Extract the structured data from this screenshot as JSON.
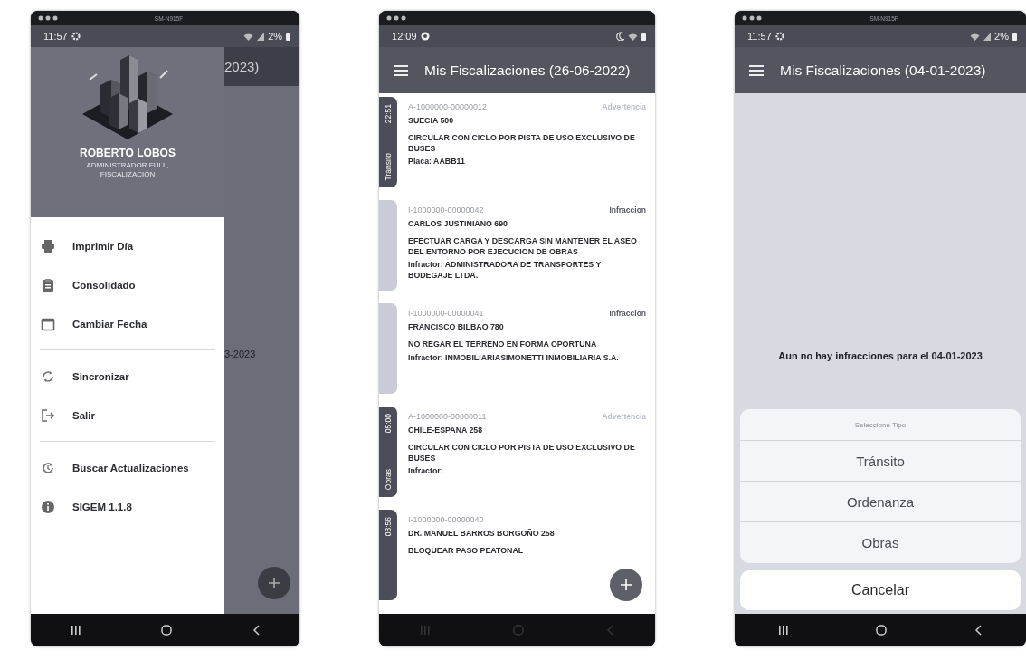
{
  "phones": [
    {
      "kind": "drawer",
      "device_label": "SM-N915F",
      "status_bar": {
        "time": "11:57",
        "battery": "2%"
      },
      "background": {
        "title_fragment": "2023)",
        "text_fragment": "3-2023"
      },
      "drawer": {
        "user_name": "ROBERTO LOBOS",
        "user_role": "ADMINISTRADOR FULL, FISCALIZACIÓN",
        "sections": [
          [
            {
              "label": "Imprimir Día"
            },
            {
              "label": "Consolidado"
            },
            {
              "label": "Cambiar Fecha"
            }
          ],
          [
            {
              "label": "Sincronizar"
            },
            {
              "label": "Salir"
            }
          ],
          [
            {
              "label": "Buscar Actualizaciones"
            },
            {
              "label": "SIGEM 1.1.8"
            }
          ]
        ]
      }
    },
    {
      "kind": "list",
      "status_bar": {
        "time": "12:09"
      },
      "app_bar": {
        "title": "Mis Fiscalizaciones (26-06-2022)"
      },
      "records": [
        {
          "tab": {
            "time": "22:51",
            "type": "Tránsito",
            "color": "#4b4e58"
          },
          "number": "A-1000000-00000012",
          "status": {
            "label": "Advertencia",
            "color": "#b9bdc8"
          },
          "address": "SUECIA 500",
          "description": "CIRCULAR CON CICLO POR PISTA DE USO EXCLUSIVO DE BUSES",
          "detail": "Placa: AABB11"
        },
        {
          "tab": {
            "color": "#c9ccd6"
          },
          "number": "I-1000000-00000042",
          "status": {
            "label": "Infraccion",
            "color": "#555861"
          },
          "address": "CARLOS JUSTINIANO 690",
          "description": "EFECTUAR CARGA Y DESCARGA SIN MANTENER EL ASEO DEL ENTORNO POR EJECUCION DE OBRAS",
          "detail": "Infractor: ADMINISTRADORA DE TRANSPORTES Y BODEGAJE LTDA."
        },
        {
          "tab": {
            "color": "#c9ccd6"
          },
          "number": "I-1000000-00000041",
          "status": {
            "label": "Infraccion",
            "color": "#555861"
          },
          "address": "FRANCISCO BILBAO 780",
          "description": "NO REGAR EL TERRENO EN FORMA OPORTUNA",
          "detail": "Infractor: INMOBILIARIASIMONETTI INMOBILIARIA S.A."
        },
        {
          "tab": {
            "time": "05:00",
            "type": "Obras",
            "color": "#4b4e58"
          },
          "number": "A-1000000-00000011",
          "status": {
            "label": "Advertencia",
            "color": "#b9bdc8"
          },
          "address": "CHILE-ESPAÑA 258",
          "description": "CIRCULAR CON CICLO POR PISTA DE USO EXCLUSIVO DE BUSES",
          "detail": "Infractor:"
        },
        {
          "tab": {
            "time": "03:56",
            "color": "#4b4e58"
          },
          "number": "I-1000000-00000040",
          "address": "DR. MANUEL BARROS BORGOÑO 258",
          "description": "BLOQUEAR PASO PEATONAL"
        }
      ]
    },
    {
      "kind": "sheet",
      "device_label": "SM-N915F",
      "status_bar": {
        "time": "11:57",
        "battery": "2%"
      },
      "app_bar": {
        "title": "Mis Fiscalizaciones (04-01-2023)"
      },
      "message": "Aun no hay infracciones para el 04-01-2023",
      "sheet": {
        "title": "Seleccione Tipo",
        "options": [
          "Tránsito",
          "Ordenanza",
          "Obras"
        ],
        "cancel": "Cancelar"
      }
    }
  ]
}
